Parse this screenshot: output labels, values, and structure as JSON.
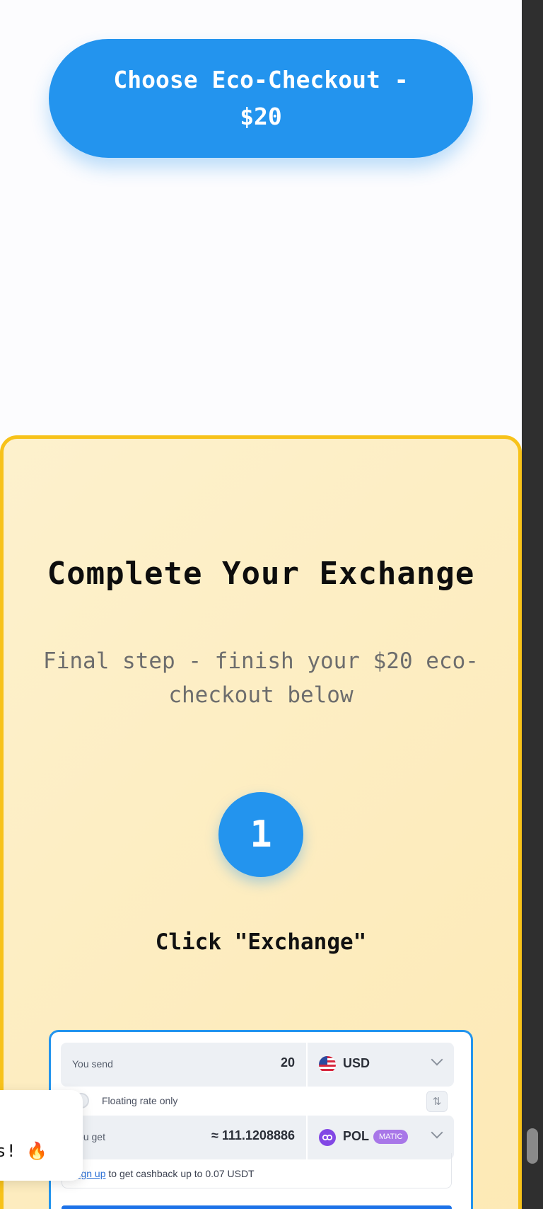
{
  "cta": {
    "label": "Choose Eco-Checkout - $20"
  },
  "panel": {
    "title": "Complete Your Exchange",
    "subtitle": "Final step - finish your $20 eco-checkout below",
    "step_number": "1",
    "step_label": "Click \"Exchange\""
  },
  "widget": {
    "send_label": "You send",
    "send_value": "20",
    "send_currency": "USD",
    "floating_text": "Floating rate only",
    "get_label": "You get",
    "get_value": "≈ 111.1208886",
    "get_currency": "POL",
    "get_network": "MATIC",
    "cashback_link": "Sign up",
    "cashback_text": " to get cashback up to 0.07 USDT"
  },
  "toast": {
    "text": "s! ",
    "emoji": "🔥"
  },
  "colors": {
    "accent": "#2394ee",
    "panel_border": "#f7c21a",
    "network_badge": "#a877e8"
  }
}
